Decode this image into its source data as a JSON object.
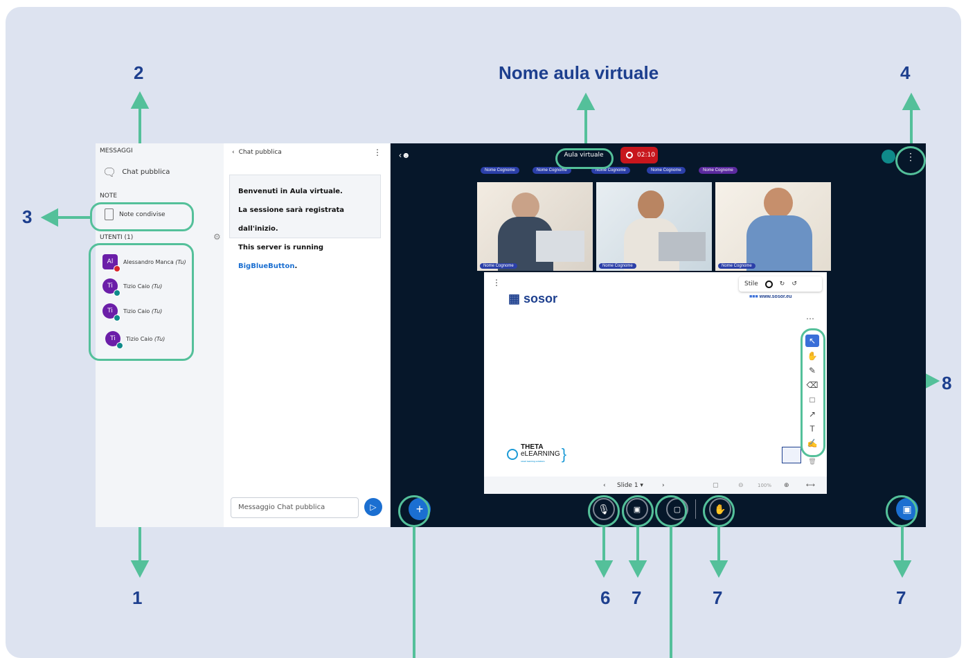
{
  "header": {
    "title": "Nome aula virtuale"
  },
  "numbers": {
    "n1": "1",
    "n2": "2",
    "n3": "3",
    "n4": "4",
    "n6": "6",
    "n7a": "7",
    "n7b": "7",
    "n7c": "7",
    "n8": "8"
  },
  "sidebar": {
    "messages_heading": "MESSAGGI",
    "public_chat": "Chat pubblica",
    "notes_heading": "NOTE",
    "shared_notes": "Note condivise",
    "users_heading": "UTENTI (1)",
    "users": [
      {
        "initials": "Al",
        "name": "Alessandro Manca",
        "you": "(Tu)"
      },
      {
        "initials": "Ti",
        "name": "Tizio Caio",
        "you": "(Tu)"
      },
      {
        "initials": "Ti",
        "name": "Tizio Caio",
        "you": "(Tu)"
      },
      {
        "initials": "Ti",
        "name": "Tizio Caio",
        "you": "(Tu)"
      }
    ]
  },
  "chat": {
    "back_label": "Chat pubblica",
    "welcome": "Benvenuti in Aula virtuale.",
    "recorded": "La sessione sarà registrata dall'inizio.",
    "server_prefix": "This server is running ",
    "server_link": "BigBlueButton",
    "server_suffix": ".",
    "input_placeholder": "Messaggio Chat pubblica"
  },
  "main": {
    "room_name": "Aula virtuale",
    "record_time": "02:10",
    "talkers": [
      "Nome Cognome",
      "Nome Cognome",
      "Nome Cognome",
      "Nome Cognome",
      "Nome Cognome"
    ],
    "videos": [
      "Nome Cognome",
      "Nome Cognome",
      "Nome Cognome"
    ]
  },
  "whiteboard": {
    "style_label": "Stile",
    "brand": "sosor",
    "website": "www.sosor.eu",
    "theta_line1": "THETA",
    "theta_line2": "eLEARNING",
    "theta_tagline": "smart learning solutions",
    "slide_label": "Slide 1",
    "zoom": "100%",
    "tools": [
      "select-icon",
      "hand-icon",
      "pencil-icon",
      "eraser-icon",
      "rectangle-icon",
      "arrow-icon",
      "text-icon",
      "note-icon"
    ]
  },
  "colors": {
    "accent": "#54c09a",
    "label": "#1d3f8e",
    "dark_bg": "#06172a",
    "record": "#c8161d",
    "primary": "#1b6fd1"
  }
}
